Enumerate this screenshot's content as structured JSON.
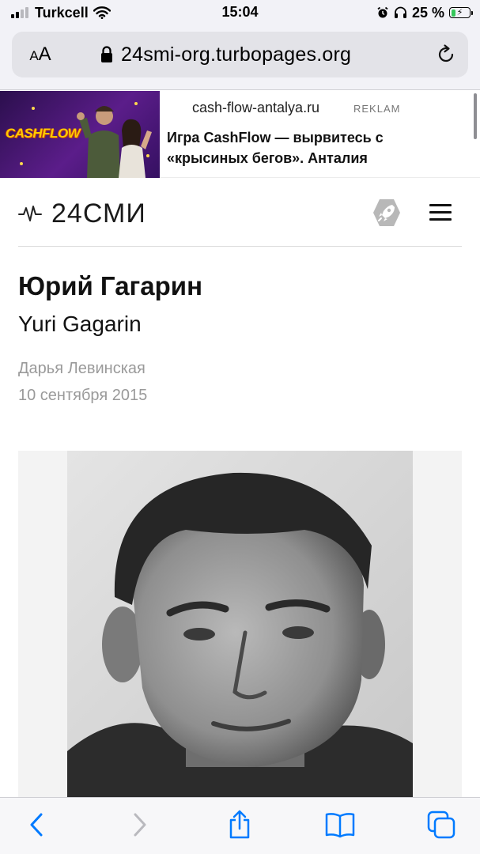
{
  "status_bar": {
    "carrier": "Turkcell",
    "time": "15:04",
    "battery_percent": "25 %",
    "battery_level": 0.25,
    "icons": [
      "signal-icon",
      "wifi-icon",
      "alarm-icon",
      "headphones-icon",
      "battery-charging-icon"
    ]
  },
  "browser": {
    "text_size_label_small": "A",
    "text_size_label_large": "A",
    "url": "24smi-org.turbopages.org",
    "icons": [
      "lock-icon",
      "reload-icon"
    ]
  },
  "ad": {
    "logo_text": "CASHFLOW",
    "domain": "cash-flow-antalya.ru",
    "tag": "REKLAM",
    "title": "Игра CashFlow — вырвитесь с «крысиных бегов». Анталия"
  },
  "site": {
    "logo_text": "24СМИ",
    "icons": [
      "pulse-icon",
      "rocket-icon",
      "menu-icon"
    ]
  },
  "article": {
    "title": "Юрий Гагарин",
    "subtitle": "Yuri Gagarin",
    "author": "Дарья Левинская",
    "date": "10 сентября 2015"
  },
  "toolbar": {
    "icons": [
      "back-icon",
      "forward-icon",
      "share-icon",
      "bookmarks-icon",
      "tabs-icon"
    ],
    "back_enabled": true,
    "forward_enabled": false,
    "accent_color": "#007aff",
    "disabled_color": "#b9b9be"
  }
}
